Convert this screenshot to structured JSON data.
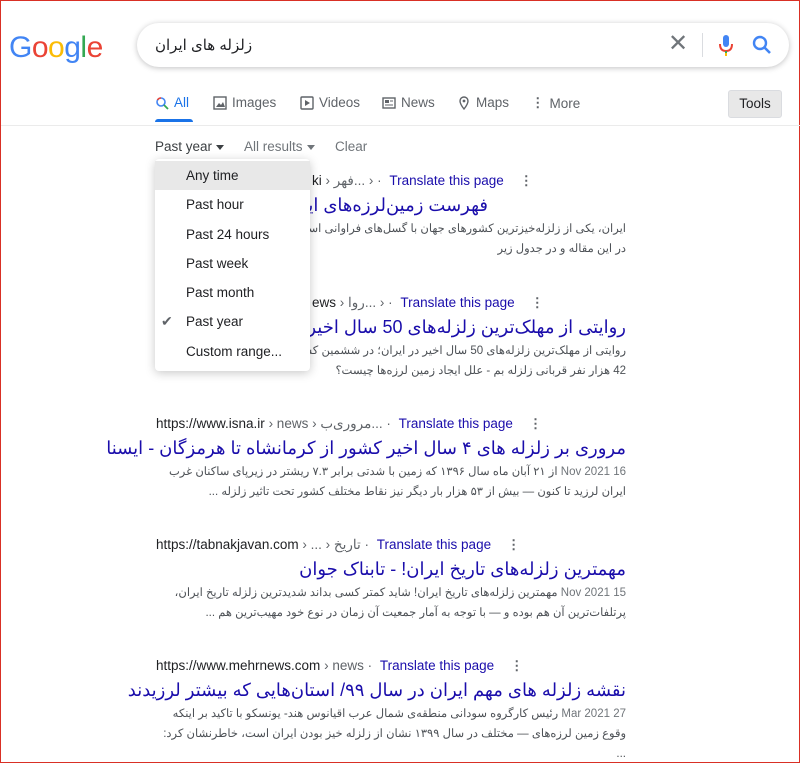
{
  "brand": {
    "logo_letters": [
      "G",
      "o",
      "o",
      "g",
      "l",
      "e"
    ],
    "logo_colors": [
      "#4285f4",
      "#ea4335",
      "#fbbc05",
      "#4285f4",
      "#34a853",
      "#ea4335"
    ],
    "accent": "#1a73e8",
    "link_color": "#1a0dab"
  },
  "search": {
    "query": "زلزله های ایران",
    "clear_icon": "close-icon",
    "mic_icon": "microphone-icon",
    "search_icon": "search-icon"
  },
  "tabs": [
    {
      "label": "All",
      "icon": "search-icon",
      "active": true
    },
    {
      "label": "Images",
      "icon": "image-icon"
    },
    {
      "label": "Videos",
      "icon": "play-icon"
    },
    {
      "label": "News",
      "icon": "newspaper-icon"
    },
    {
      "label": "Maps",
      "icon": "map-pin-icon"
    },
    {
      "label": "More",
      "icon": "more-vert-icon"
    }
  ],
  "tools_label": "Tools",
  "filters": {
    "time": "Past year",
    "results": "All results",
    "clear": "Clear"
  },
  "dropdown": {
    "items": [
      "Any time",
      "Past hour",
      "Past 24 hours",
      "Past week",
      "Past month",
      "Past year",
      "Custom range..."
    ],
    "hovered": "Any time",
    "checked": "Past year"
  },
  "translate_label": "Translate this page",
  "results": [
    {
      "site_tail": "ki",
      "path": "› فهر... ›",
      "title": "فهرست زمین‌لرزه‌های ایران",
      "snippet": "ایران، یکی از زلزله‌خیزترین کشورهای جهان با گسل‌های فراوانی است که حدود ۹۰٪ ... می‌پوشاند. در این مقاله و در جدول زیر"
    },
    {
      "site_tail": "ews",
      "path": "› روا... ›",
      "title": "روایتی از مهلک‌ترین زلزله‌های 50 سال اخیر ا",
      "snippet": "روایتی از مهلک‌ترین زلزله‌های 50 سال اخیر در ایران؛ در ششمین کشور زلزله‌خیز جهان چه ... دی 42 هزار نفر قربانی زلزله بم - علل ایجاد زمین لرزه‌ها چیست؟"
    },
    {
      "url": "https://www.isna.ir",
      "path": "› news › مروری‌ب...",
      "title": "مروری بر زلزله های ۴ سال اخیر کشور از کرمانشاه تا هرمزگان - ایسنا",
      "date": "16 Nov 2021",
      "snippet": "از ۲۱ آبان ماه سال ۱۳۹۶ که زمین با شدتی برابر ۷.۳ ریشتر در زیرپای ساکنان غرب ایران لرزید تا کنون — بیش از ۵۳ هزار بار دیگر نیز نقاط مختلف کشور تحت تاثیر زلزله ..."
    },
    {
      "url": "https://tabnakjavan.com",
      "path": "› ... › تاریخ",
      "title": "مهمترین زلزله‌های تاریخ ایران! - تابناک جوان",
      "date": "15 Nov 2021",
      "snippet": "مهمترین زلزله‌های تاریخ ایران! شاید کمتر کسی بداند شدیدترین زلزله تاریخ ایران، پرتلفات‌ترین آن هم بوده و — با توجه به آمار جمعیت آن زمان در نوع خود مهیب‌ترین هم ..."
    },
    {
      "url": "https://www.mehrnews.com",
      "path": "› news",
      "title": "نقشه زلزله های مهم ایران در سال ۹۹/ استان‌هایی که بیشتر لرزیدند",
      "date": "27 Mar 2021",
      "snippet": "رئیس کارگروه سودانی منطقه‌ی شمال عرب اقیانوس هند- یونسکو با تاکید بر اینکه وقوع زمین لرزه‌های — مختلف در سال ۱۳۹۹ نشان از زلزله خیز بودن ایران است، خاطرنشان کرد: ..."
    }
  ]
}
